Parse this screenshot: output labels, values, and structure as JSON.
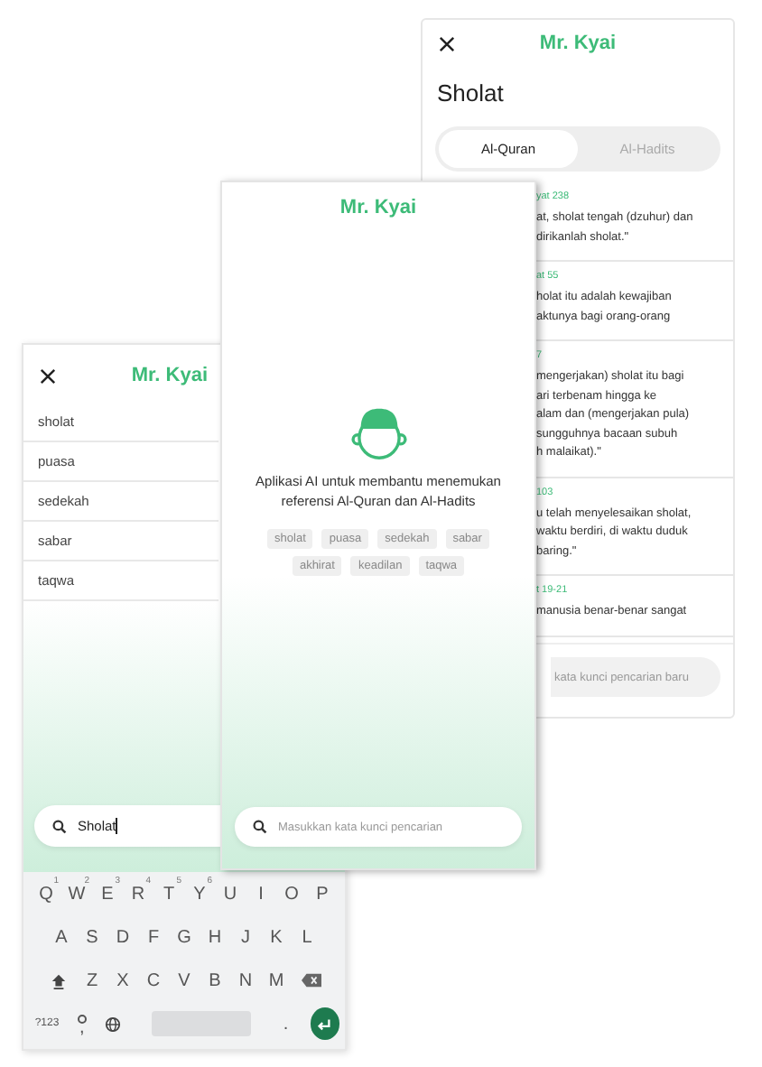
{
  "results_screen": {
    "title": "Mr. Kyai",
    "heading": "Sholat",
    "tabs": [
      {
        "label": "Al-Quran",
        "selected": true
      },
      {
        "label": "Al-Hadits",
        "selected": false
      }
    ],
    "results": [
      {
        "reference": "yat 238",
        "text": "at, sholat tengah (dzuhur) dan\ndirikanlah sholat.\""
      },
      {
        "reference": "at 55",
        "text": "holat itu adalah kewajiban\naktunya bagi orang-orang"
      },
      {
        "reference": "7",
        "text": "mengerjakan) sholat itu bagi\nari terbenam hingga ke\nalam dan (mengerjakan pula)\nsungguhnya bacaan subuh\nh malaikat).\""
      },
      {
        "reference": "103",
        "text": "u telah menyelesaikan sholat,\nwaktu berdiri, di waktu duduk\nbaring.\""
      },
      {
        "reference": "t 19-21",
        "text": "manusia benar-benar sangat"
      }
    ],
    "search": {
      "placeholder": "kata kunci pencarian baru"
    }
  },
  "home_screen": {
    "title": "Mr. Kyai",
    "description": "Aplikasi AI untuk membantu menemukan referensi Al-Quran dan Al-Hadits",
    "topics": [
      "sholat",
      "puasa",
      "sedekah",
      "sabar",
      "akhirat",
      "keadilan",
      "taqwa"
    ],
    "search": {
      "placeholder": "Masukkan kata kunci pencarian"
    }
  },
  "search_screen": {
    "title": "Mr. Kyai",
    "suggestions": [
      "sholat",
      "puasa",
      "sedekah",
      "sabar",
      "taqwa"
    ],
    "search": {
      "value": "Sholat"
    },
    "keyboard": {
      "rows": [
        [
          {
            "kind": "letter",
            "label": "Q",
            "hint": "1"
          },
          {
            "kind": "letter",
            "label": "W",
            "hint": "2"
          },
          {
            "kind": "letter",
            "label": "E",
            "hint": "3"
          },
          {
            "kind": "letter",
            "label": "R",
            "hint": "4"
          },
          {
            "kind": "letter",
            "label": "T",
            "hint": "5"
          },
          {
            "kind": "letter",
            "label": "Y",
            "hint": "6"
          },
          {
            "kind": "letter",
            "label": "U"
          },
          {
            "kind": "letter",
            "label": "I"
          },
          {
            "kind": "letter",
            "label": "O"
          },
          {
            "kind": "letter",
            "label": "P"
          }
        ],
        [
          {
            "kind": "letter",
            "label": "A"
          },
          {
            "kind": "letter",
            "label": "S"
          },
          {
            "kind": "letter",
            "label": "D"
          },
          {
            "kind": "letter",
            "label": "F"
          },
          {
            "kind": "letter",
            "label": "G"
          },
          {
            "kind": "letter",
            "label": "H"
          },
          {
            "kind": "letter",
            "label": "J"
          },
          {
            "kind": "letter",
            "label": "K"
          },
          {
            "kind": "letter",
            "label": "L"
          }
        ],
        [
          {
            "kind": "shift"
          },
          {
            "kind": "letter",
            "label": "Z"
          },
          {
            "kind": "letter",
            "label": "X"
          },
          {
            "kind": "letter",
            "label": "C"
          },
          {
            "kind": "letter",
            "label": "V"
          },
          {
            "kind": "letter",
            "label": "B"
          },
          {
            "kind": "letter",
            "label": "N"
          },
          {
            "kind": "letter",
            "label": "M"
          },
          {
            "kind": "backspace"
          }
        ],
        [
          {
            "kind": "symbols",
            "label": "?123"
          },
          {
            "kind": "comma",
            "label": ","
          },
          {
            "kind": "globe"
          },
          {
            "kind": "space"
          },
          {
            "kind": "period",
            "label": "."
          },
          {
            "kind": "enter"
          }
        ]
      ]
    }
  }
}
